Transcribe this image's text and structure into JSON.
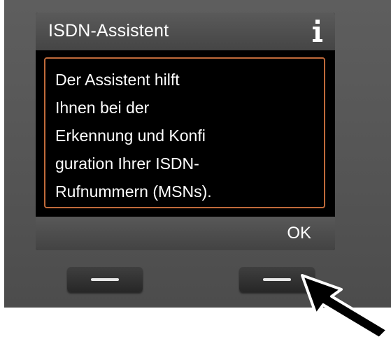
{
  "screen": {
    "title": "ISDN-Assistent",
    "info_icon": "info-icon",
    "message_lines": [
      "Der Assistent hilft",
      "Ihnen bei der",
      "Erkennung und Konfi",
      "guration Ihrer ISDN-",
      "Rufnummern (MSNs)."
    ],
    "softkey_right_label": "OK"
  },
  "hardware_keys": {
    "left": "softkey-left",
    "right": "softkey-right"
  },
  "colors": {
    "frame_border": "#c06a3a",
    "screen_bg": "#000000",
    "device_body": "#545454",
    "pointer_arrow": "#000000"
  }
}
